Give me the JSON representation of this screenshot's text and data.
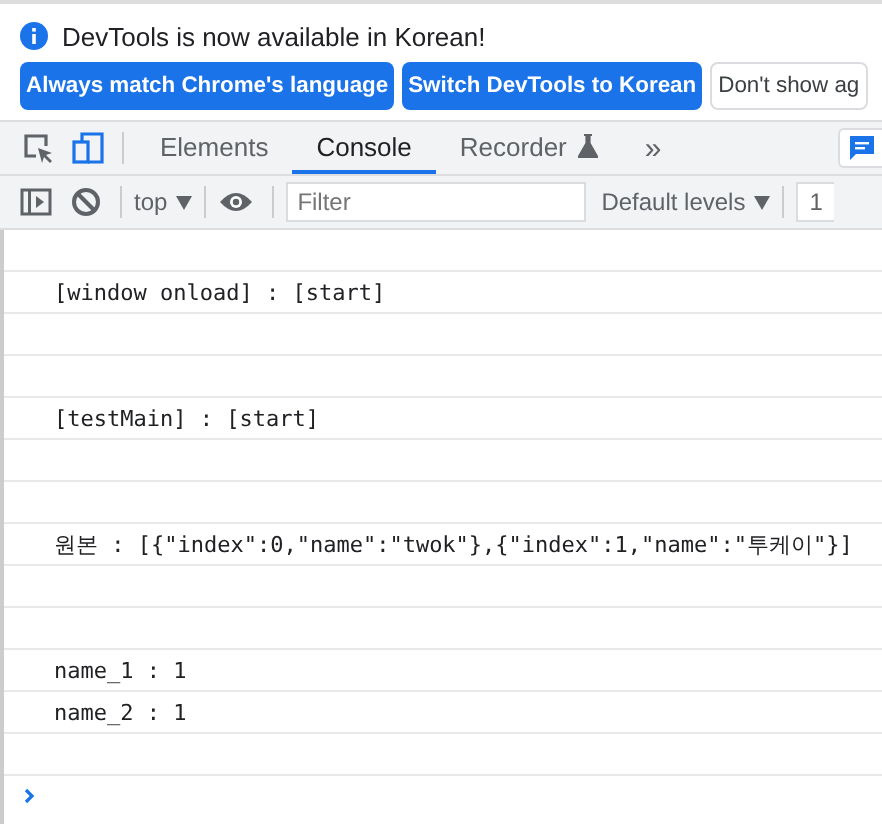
{
  "infobar": {
    "message": "DevTools is now available in Korean!",
    "buttons": [
      {
        "label": "Always match Chrome's language",
        "kind": "primary"
      },
      {
        "label": "Switch DevTools to Korean",
        "kind": "primary"
      },
      {
        "label": "Don't show ag",
        "kind": "secondary"
      }
    ]
  },
  "tabs": [
    {
      "label": "Elements",
      "selected": false
    },
    {
      "label": "Console",
      "selected": true
    },
    {
      "label": "Recorder",
      "selected": false,
      "experimental": true
    }
  ],
  "more_tabs": "»",
  "toolbar": {
    "context": "top",
    "filter_placeholder": "Filter",
    "levels": "Default levels",
    "issues": "1"
  },
  "console": [
    {
      "kind": "blank"
    },
    {
      "kind": "message",
      "text": "[window onload] : [start]"
    },
    {
      "kind": "blank"
    },
    {
      "kind": "blank"
    },
    {
      "kind": "message",
      "text": "[testMain] : [start]"
    },
    {
      "kind": "blank"
    },
    {
      "kind": "blank"
    },
    {
      "kind": "message",
      "text": "원본 : [{\"index\":0,\"name\":\"twok\"},{\"index\":1,\"name\":\"투케이\"}]"
    },
    {
      "kind": "blank"
    },
    {
      "kind": "blank"
    },
    {
      "kind": "message",
      "text": "name_1 : 1"
    },
    {
      "kind": "message",
      "text": "name_2 : 1"
    },
    {
      "kind": "blank"
    },
    {
      "kind": "prompt"
    }
  ]
}
